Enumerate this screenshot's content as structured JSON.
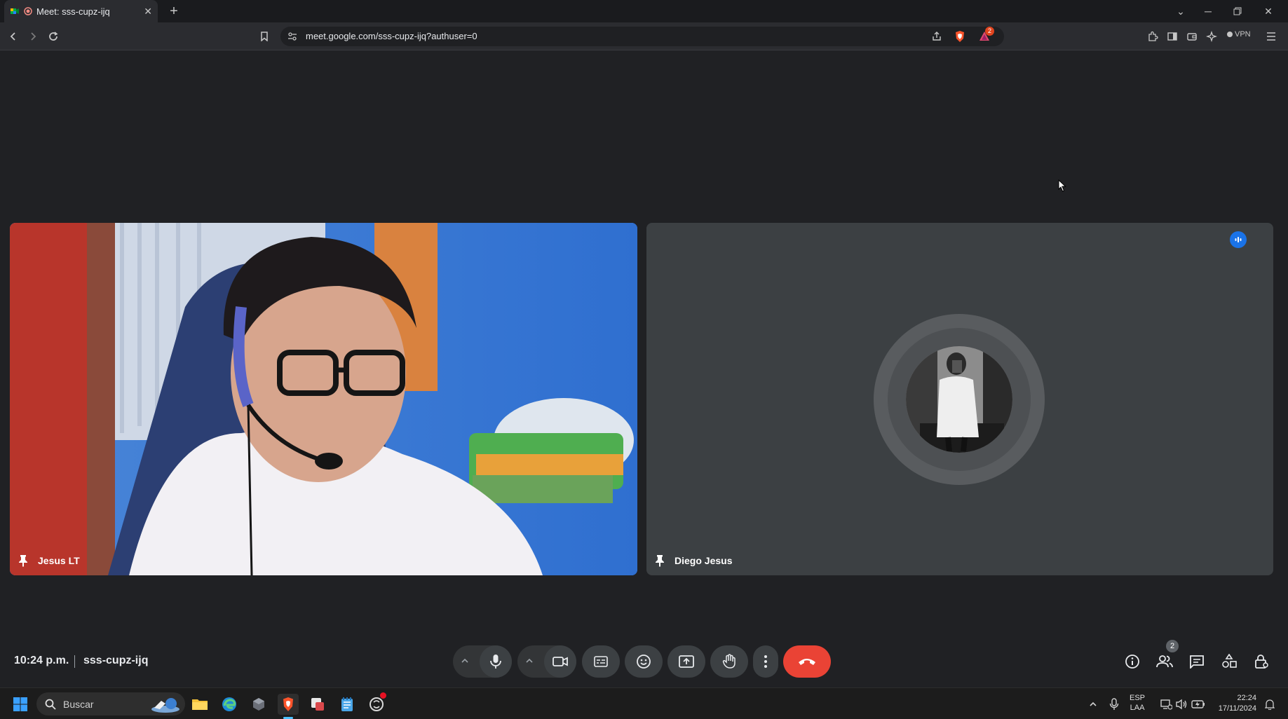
{
  "browser": {
    "tab_title": "Meet: sss-cupz-ijq",
    "url": "meet.google.com/sss-cupz-ijq?authuser=0",
    "vpn_label": "VPN",
    "notification_badge": "2"
  },
  "meeting": {
    "time": "10:24 p.m.",
    "code": "sss-cupz-ijq",
    "participants_count": "2"
  },
  "participants": [
    {
      "name": "Jesus LT"
    },
    {
      "name": "Diego Jesus"
    }
  ],
  "taskbar": {
    "search_placeholder": "Buscar",
    "lang_top": "ESP",
    "lang_bottom": "LAA",
    "clock_time": "22:24",
    "clock_date": "17/11/2024"
  },
  "colors": {
    "end_call": "#ea4335",
    "stage_bg": "#202124",
    "tile_bg": "#3c4043",
    "speaking_indicator": "#1a73e8"
  }
}
